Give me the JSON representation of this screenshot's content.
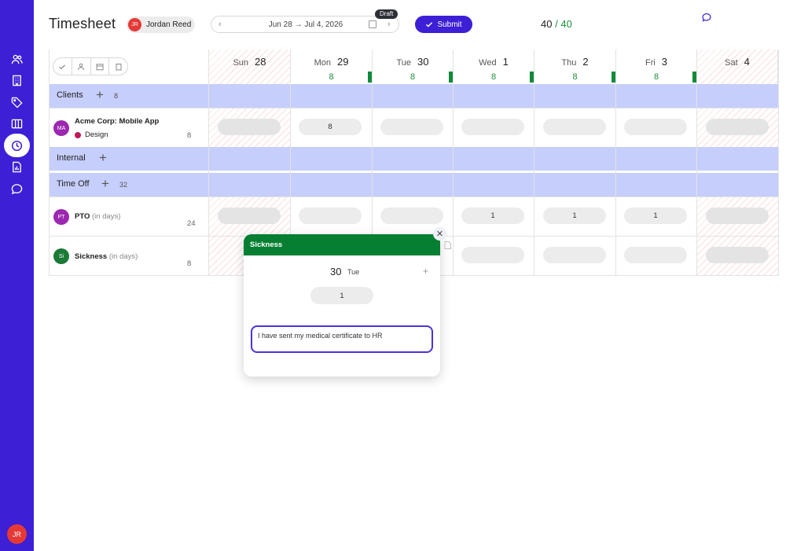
{
  "app": {
    "title": "Timesheet",
    "user": {
      "initials": "JR",
      "name": "Jordan Reed"
    },
    "date_range": "Jun 28 → Jul 4, 2026",
    "status_badge": "Draft",
    "submit_label": "Submit",
    "hours": {
      "logged": "40",
      "separator": "/",
      "total": "40"
    }
  },
  "sidebar": {
    "items": [
      {
        "icon": "users-icon"
      },
      {
        "icon": "building-icon"
      },
      {
        "icon": "tag-icon"
      },
      {
        "icon": "board-icon"
      },
      {
        "icon": "clock-icon",
        "active": true
      },
      {
        "icon": "report-icon"
      },
      {
        "icon": "chat-icon"
      }
    ],
    "avatar_initials": "JR",
    "colors": {
      "bg": "#3d1fd6",
      "accent": "#ffffff"
    }
  },
  "days": [
    {
      "name": "Sun",
      "num": "28",
      "hours": "",
      "weekend": true
    },
    {
      "name": "Mon",
      "num": "29",
      "hours": "8",
      "weekend": false
    },
    {
      "name": "Tue",
      "num": "30",
      "hours": "8",
      "weekend": false
    },
    {
      "name": "Wed",
      "num": "1",
      "hours": "8",
      "weekend": false
    },
    {
      "name": "Thu",
      "num": "2",
      "hours": "8",
      "weekend": false
    },
    {
      "name": "Fri",
      "num": "3",
      "hours": "8",
      "weekend": false
    },
    {
      "name": "Sat",
      "num": "4",
      "hours": "",
      "weekend": true
    }
  ],
  "sections": {
    "clients": {
      "label": "Clients",
      "count": "8"
    },
    "internal": {
      "label": "Internal",
      "count": ""
    },
    "timeoff": {
      "label": "Time Off",
      "count": "32"
    }
  },
  "rows": {
    "acme": {
      "initials": "MA",
      "name": "Acme Corp: Mobile App",
      "task": "Design",
      "total": "8",
      "values": [
        "",
        "8",
        "",
        "",
        "",
        "",
        ""
      ]
    },
    "pto": {
      "initials": "PT",
      "name": "PTO",
      "unit": "(in days)",
      "total": "24",
      "values": [
        "",
        "",
        "",
        "1",
        "1",
        "1",
        ""
      ]
    },
    "sick": {
      "initials": "Si",
      "name": "Sickness",
      "unit": "(in days)",
      "total": "8",
      "values": [
        "",
        "",
        "",
        "",
        "",
        "",
        ""
      ]
    }
  },
  "popup": {
    "title": "Sickness",
    "date": "30",
    "weekday": "Tue",
    "value": "1",
    "note": "I have sent my medical certificate to HR"
  },
  "colors": {
    "brand": "#3d1fd6",
    "section_bg": "#c6cefb",
    "green": "#067f32",
    "hours_green": "#1b8f3a"
  }
}
